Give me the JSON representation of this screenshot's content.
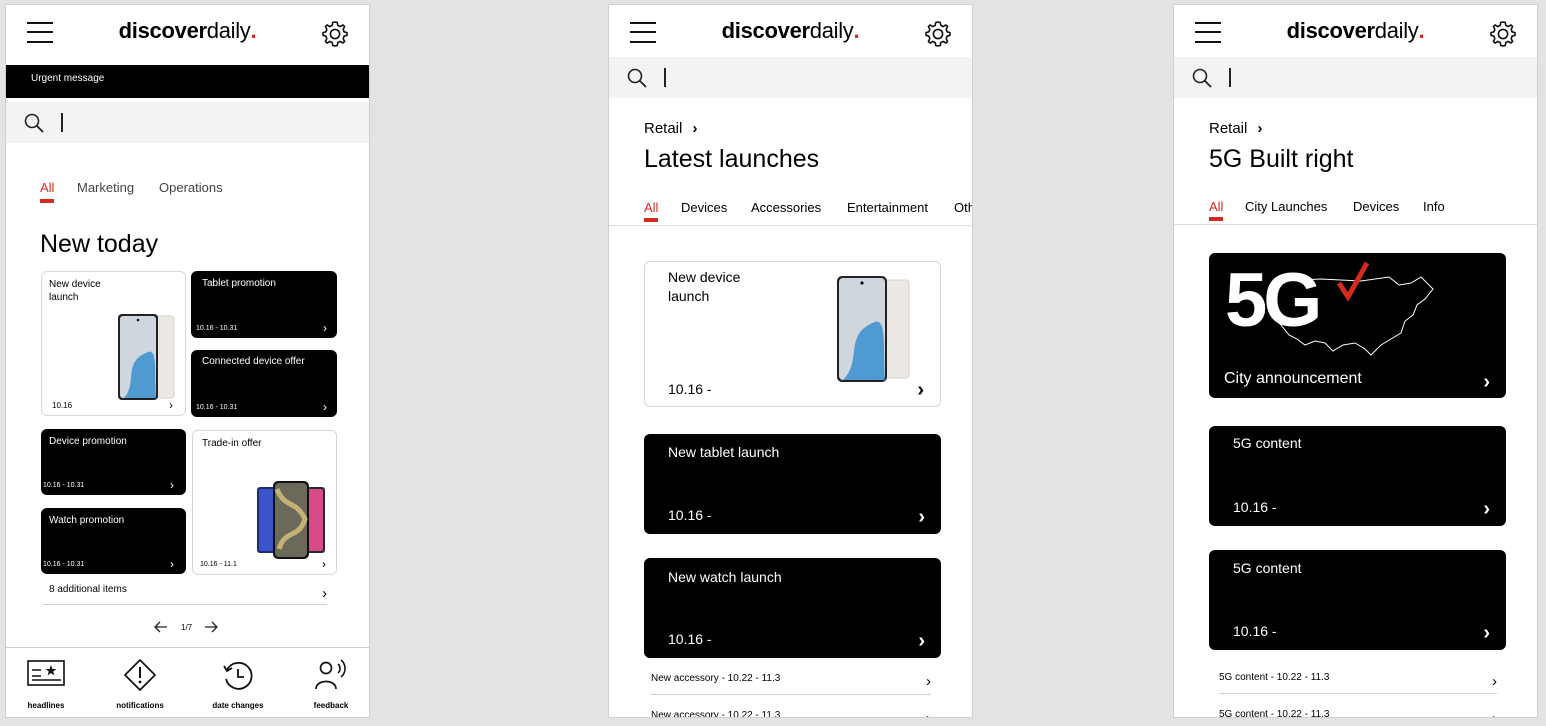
{
  "app": {
    "logo_bold": "discover",
    "logo_light": "daily",
    "logo_dot": ".",
    "accent_color": "#d52b1e"
  },
  "icons": {
    "menu": "hamburger-menu-icon",
    "settings": "gear-icon",
    "search": "search-icon",
    "chevron": "chevron-right-icon"
  },
  "screen1": {
    "urgent_message": "Urgent message",
    "tabs": [
      "All",
      "Marketing",
      "Operations"
    ],
    "active_tab": "All",
    "heading": "New today",
    "cards": [
      {
        "title": "New device launch",
        "date": "10.16"
      },
      {
        "title": "Tablet promotion",
        "date": "10.16 - 10.31"
      },
      {
        "title": "Connected device offer",
        "date": "10.16 - 10.31"
      },
      {
        "title": "Device promotion",
        "date": "10.16 - 10.31"
      },
      {
        "title": "Trade-in offer",
        "date": "10.16 - 11.1"
      },
      {
        "title": "Watch promotion",
        "date": "10.16 - 10.31"
      }
    ],
    "additional_items": "8 additional items",
    "pager": "1/7",
    "nav": [
      {
        "label": "headlines",
        "icon": "headlines-icon"
      },
      {
        "label": "notifications",
        "icon": "alert-diamond-icon"
      },
      {
        "label": "date changes",
        "icon": "history-clock-icon"
      },
      {
        "label": "feedback",
        "icon": "speaking-person-icon"
      }
    ]
  },
  "screen2": {
    "breadcrumb": "Retail",
    "title": "Latest launches",
    "tabs": [
      "All",
      "Devices",
      "Accessories",
      "Entertainment",
      "Oth"
    ],
    "active_tab": "All",
    "cards": [
      {
        "title": "New device launch",
        "date": "10.16 -"
      },
      {
        "title": "New tablet launch",
        "date": "10.16 -"
      },
      {
        "title": "New watch launch",
        "date": "10.16 -"
      }
    ],
    "list": [
      "New accessory - 10.22 - 11.3",
      "New accessory - 10.22 - 11.3"
    ]
  },
  "screen3": {
    "breadcrumb": "Retail",
    "title": "5G Built right",
    "tabs": [
      "All",
      "City Launches",
      "Devices",
      "Info"
    ],
    "active_tab": "All",
    "hero": {
      "badge": "5G",
      "caption": "City announcement"
    },
    "cards": [
      {
        "title": "5G content",
        "date": "10.16 -"
      },
      {
        "title": "5G content",
        "date": "10.16 -"
      }
    ],
    "list": [
      "5G content - 10.22 - 11.3",
      "5G content - 10.22 - 11.3"
    ]
  }
}
